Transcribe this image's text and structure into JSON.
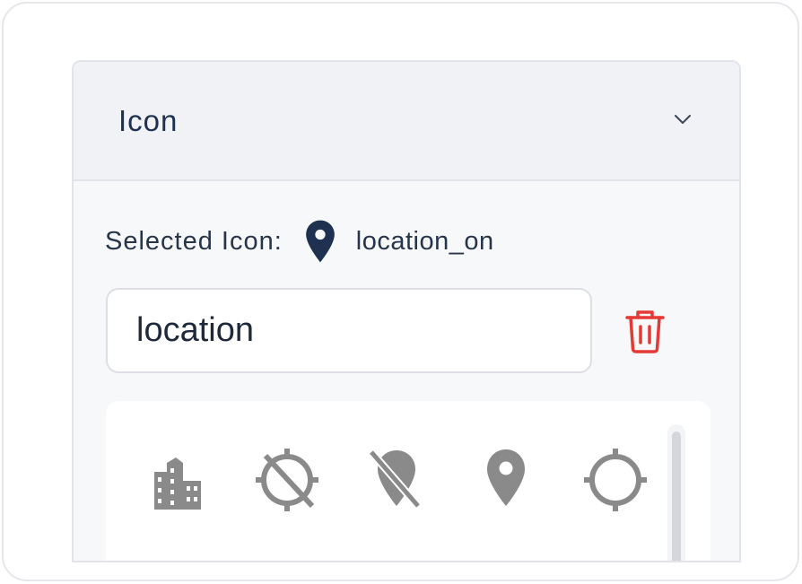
{
  "panel": {
    "title": "Icon",
    "chevron_icon": "chevron-down-icon"
  },
  "selected": {
    "label": "Selected Icon:",
    "icon": "location-pin-icon",
    "name": "location_on"
  },
  "search": {
    "value": "location"
  },
  "delete": {
    "icon": "trash-icon",
    "color": "#e53935"
  },
  "grid": {
    "icons": [
      {
        "name": "location_city",
        "icon": "city-buildings-icon"
      },
      {
        "name": "location_disabled",
        "icon": "location-disabled-icon"
      },
      {
        "name": "location_off",
        "icon": "location-off-icon"
      },
      {
        "name": "location_on",
        "icon": "location-pin-icon"
      },
      {
        "name": "location_searching",
        "icon": "location-searching-icon"
      }
    ],
    "icon_color": "#8a8a8a"
  },
  "colors": {
    "title": "#1e3150",
    "header_bg": "#f1f2f5",
    "panel_bg": "#f7f8fa",
    "accent_danger": "#e53935"
  }
}
